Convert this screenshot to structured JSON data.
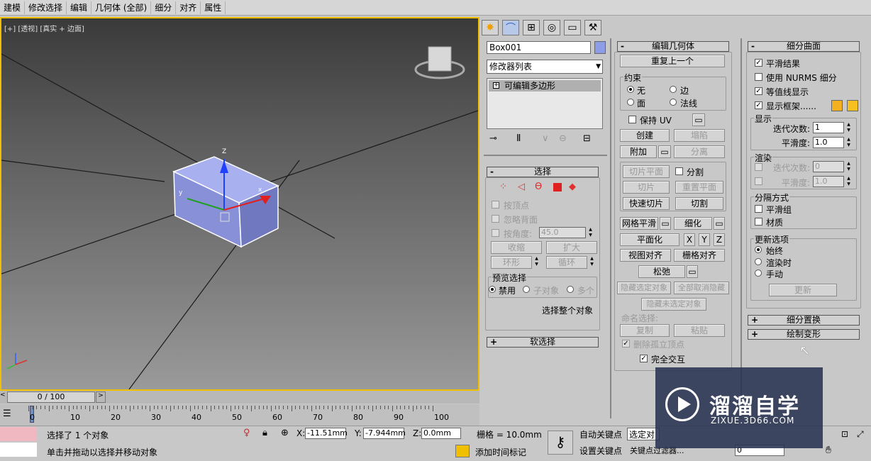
{
  "menu": [
    "建模",
    "修改选择",
    "编辑",
    "几何体 (全部)",
    "细分",
    "对齐",
    "属性"
  ],
  "viewport": {
    "label": "[+] [透视] [真实 + 边面]",
    "timeslider": "0 / 100",
    "ticks": [
      "0",
      "10",
      "20",
      "30",
      "40",
      "50",
      "60",
      "70",
      "80",
      "90",
      "100"
    ]
  },
  "tabs": [
    "create-icon",
    "modify-icon",
    "hierarchy-icon",
    "motion-icon",
    "display-icon",
    "utilities-icon"
  ],
  "object": {
    "name": "Box001",
    "color": "#8c9ce6",
    "modifier_list": "修改器列表",
    "stack_item": "可编辑多边形"
  },
  "selection": {
    "title": "选择",
    "by_vertex": "按顶点",
    "ignore_back": "忽略背面",
    "by_angle": "按角度:",
    "angle": "45.0",
    "shrink": "收缩",
    "grow": "扩大",
    "ring": "环形",
    "loop": "循环",
    "preview": "预览选择",
    "disable": "禁用",
    "subobj": "子对象",
    "multi": "多个",
    "whole": "选择整个对象",
    "soft": "软选择"
  },
  "edit_geom": {
    "title": "编辑几何体",
    "repeat": "重复上一个",
    "constraint": "约束",
    "none": "无",
    "edge": "边",
    "face": "面",
    "normal": "法线",
    "keep_uv": "保持 UV",
    "create": "创建",
    "collapse": "塌陷",
    "attach": "附加",
    "detach": "分离",
    "slice_plane": "切片平面",
    "split": "分割",
    "slice": "切片",
    "reset_plane": "重置平面",
    "quickslice": "快速切片",
    "cut": "切割",
    "meshsmooth": "网格平滑",
    "tessellate": "细化",
    "planarize": "平面化",
    "x": "X",
    "y": "Y",
    "z": "Z",
    "view_align": "视图对齐",
    "grid_align": "栅格对齐",
    "relax": "松弛",
    "hide_sel": "隐藏选定对象",
    "unhide_all": "全部取消隐藏",
    "hide_unsel": "隐藏未选定对象",
    "named_sel": "命名选择:",
    "copy": "复制",
    "paste": "粘贴",
    "del_iso": "删除孤立顶点",
    "full_interact": "完全交互"
  },
  "subdiv": {
    "title": "细分曲面",
    "smooth_result": "平滑结果",
    "nurms": "使用 NURMS 细分",
    "isoline": "等值线显示",
    "show_cage": "显示框架......",
    "cage_color1": "#f5b020",
    "cage_color2": "#f5c020",
    "display": "显示",
    "iterations": "迭代次数:",
    "iter_val": "1",
    "smoothness": "平滑度:",
    "smooth_val": "1.0",
    "render": "渲染",
    "r_iter_val": "0",
    "r_smooth_val": "1.0",
    "sep_by": "分隔方式",
    "smooth_groups": "平滑组",
    "materials": "材质",
    "update": "更新选项",
    "always": "始终",
    "when_render": "渲染时",
    "manual": "手动",
    "update_btn": "更新",
    "subdiv_disp": "细分置换",
    "paint_deform": "绘制变形"
  },
  "status": {
    "selected": "选择了 1 个对象",
    "prompt": "单击并拖动以选择并移动对象",
    "x": "-11.51mm",
    "y": "-7.944mm",
    "z": "0.0mm",
    "grid": "栅格 = 10.0mm",
    "auto_key": "自动关键点",
    "set_key": "设置关键点",
    "selected_dd": "选定对",
    "add_time": "添加时间标记",
    "key_filter": "关键点过滤器...",
    "frame": "0"
  },
  "watermark": {
    "title": "溜溜自学",
    "url": "ZIXUE.3D66.COM"
  }
}
